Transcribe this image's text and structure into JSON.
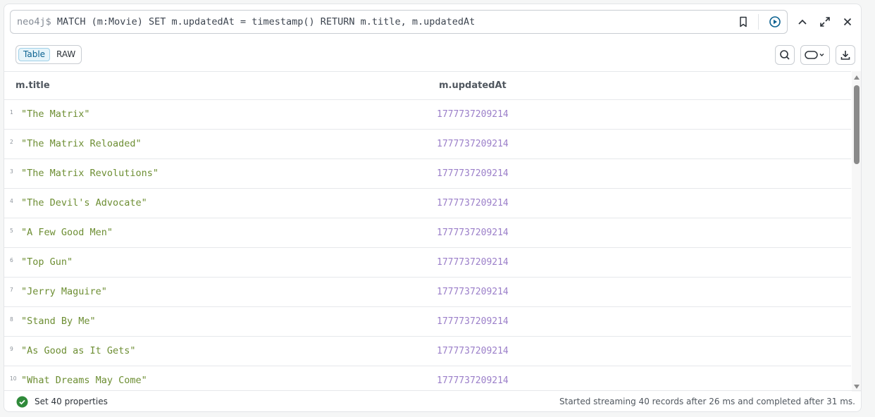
{
  "editor": {
    "prompt": "neo4j$ ",
    "query": "MATCH (m:Movie) SET m.updatedAt = timestamp() RETURN m.title, m.updatedAt",
    "icons": [
      "bookmark-icon",
      "run-icon"
    ]
  },
  "window_controls": [
    "chevron-up-icon",
    "expand-icon",
    "close-icon"
  ],
  "view_toggle": {
    "table_label": "Table",
    "raw_label": "RAW",
    "selected": "Table"
  },
  "toolbar_icons": [
    "search-icon",
    "pill-toggle-icon",
    "download-icon"
  ],
  "table": {
    "columns": [
      "m.title",
      "m.updatedAt"
    ],
    "rows": [
      {
        "index": "1",
        "title": "\"The Matrix\"",
        "updatedAt": "1777737209214"
      },
      {
        "index": "2",
        "title": "\"The Matrix Reloaded\"",
        "updatedAt": "1777737209214"
      },
      {
        "index": "3",
        "title": "\"The Matrix Revolutions\"",
        "updatedAt": "1777737209214"
      },
      {
        "index": "4",
        "title": "\"The Devil's Advocate\"",
        "updatedAt": "1777737209214"
      },
      {
        "index": "5",
        "title": "\"A Few Good Men\"",
        "updatedAt": "1777737209214"
      },
      {
        "index": "6",
        "title": "\"Top Gun\"",
        "updatedAt": "1777737209214"
      },
      {
        "index": "7",
        "title": "\"Jerry Maguire\"",
        "updatedAt": "1777737209214"
      },
      {
        "index": "8",
        "title": "\"Stand By Me\"",
        "updatedAt": "1777737209214"
      },
      {
        "index": "9",
        "title": "\"As Good as It Gets\"",
        "updatedAt": "1777737209214"
      },
      {
        "index": "10",
        "title": "\"What Dreams May Come\"",
        "updatedAt": "1777737209214"
      }
    ]
  },
  "footer": {
    "status": "Set 40 properties",
    "summary": "Started streaming 40 records after 26 ms and completed after 31 ms."
  },
  "colors": {
    "string_value": "#6d8e33",
    "number_value": "#9b7fc9",
    "accent": "#0a6190",
    "success": "#2f8a3a"
  }
}
